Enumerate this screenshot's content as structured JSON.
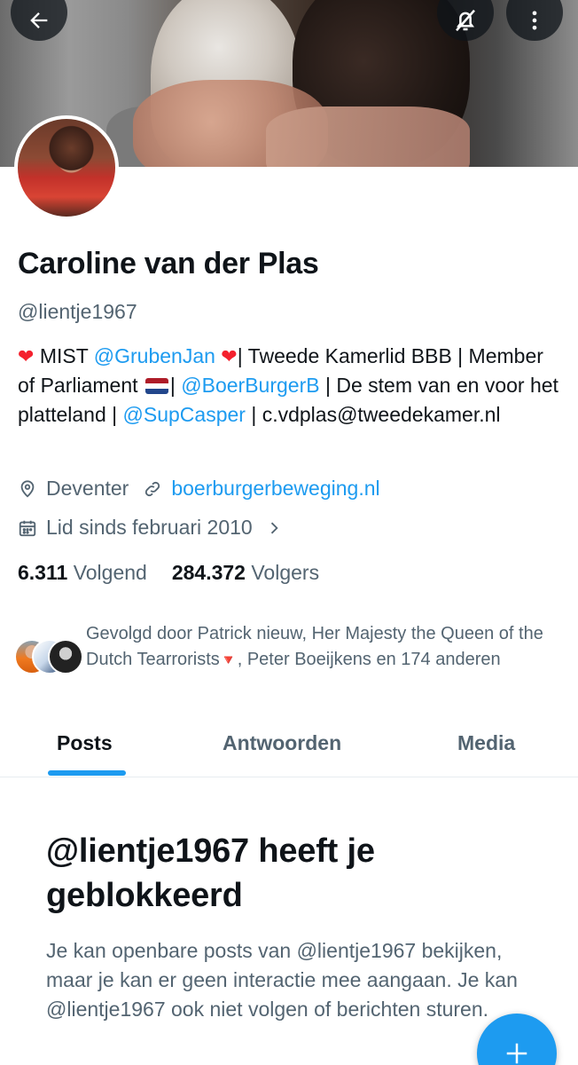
{
  "profile": {
    "name": "Caroline van der Plas",
    "handle": "@lientje1967",
    "bio": {
      "part1": " MIST ",
      "mention1": "@GrubenJan",
      "part2": "| Tweede Kamerlid BBB | Member of Parliament ",
      "part3": "| ",
      "mention2": "@BoerBurgerB",
      "part4": " | De stem van en voor het platteland | ",
      "mention3": "@SupCasper",
      "part5": " | c.vdplas@tweedekamer.nl"
    },
    "location": "Deventer",
    "website": "boerburgerbeweging.nl",
    "joined": "Lid sinds februari 2010",
    "following_count": "6.311",
    "following_label": "Volgend",
    "followers_count": "284.372",
    "followers_label": "Volgers",
    "followed_by": {
      "part1": "Gevolgd door Patrick nieuw, Her Majesty the Queen of the Dutch Tearrorists",
      "part2": ", Peter Boeijkens en 174 anderen"
    }
  },
  "tabs": [
    {
      "label": "Posts",
      "active": true
    },
    {
      "label": "Antwoorden",
      "active": false
    },
    {
      "label": "Media",
      "active": false
    }
  ],
  "blocked": {
    "title": "@lientje1967 heeft je geblokkeerd",
    "text": "Je kan openbare posts van @lientje1967 bekijken, maar je kan er geen interactie mee aangaan. Je kan @lientje1967 ook niet volgen of berichten sturen."
  },
  "icons": {
    "back": "arrow-left-icon",
    "notifications": "bell-off-icon",
    "more": "more-vertical-icon",
    "location": "location-pin-icon",
    "link": "link-icon",
    "calendar": "calendar-icon",
    "chevron": "chevron-right-icon",
    "compose": "plus-icon"
  },
  "colors": {
    "accent": "#1d9bf0",
    "text": "#0f1419",
    "secondary": "#536471",
    "heart": "#f4212e"
  }
}
